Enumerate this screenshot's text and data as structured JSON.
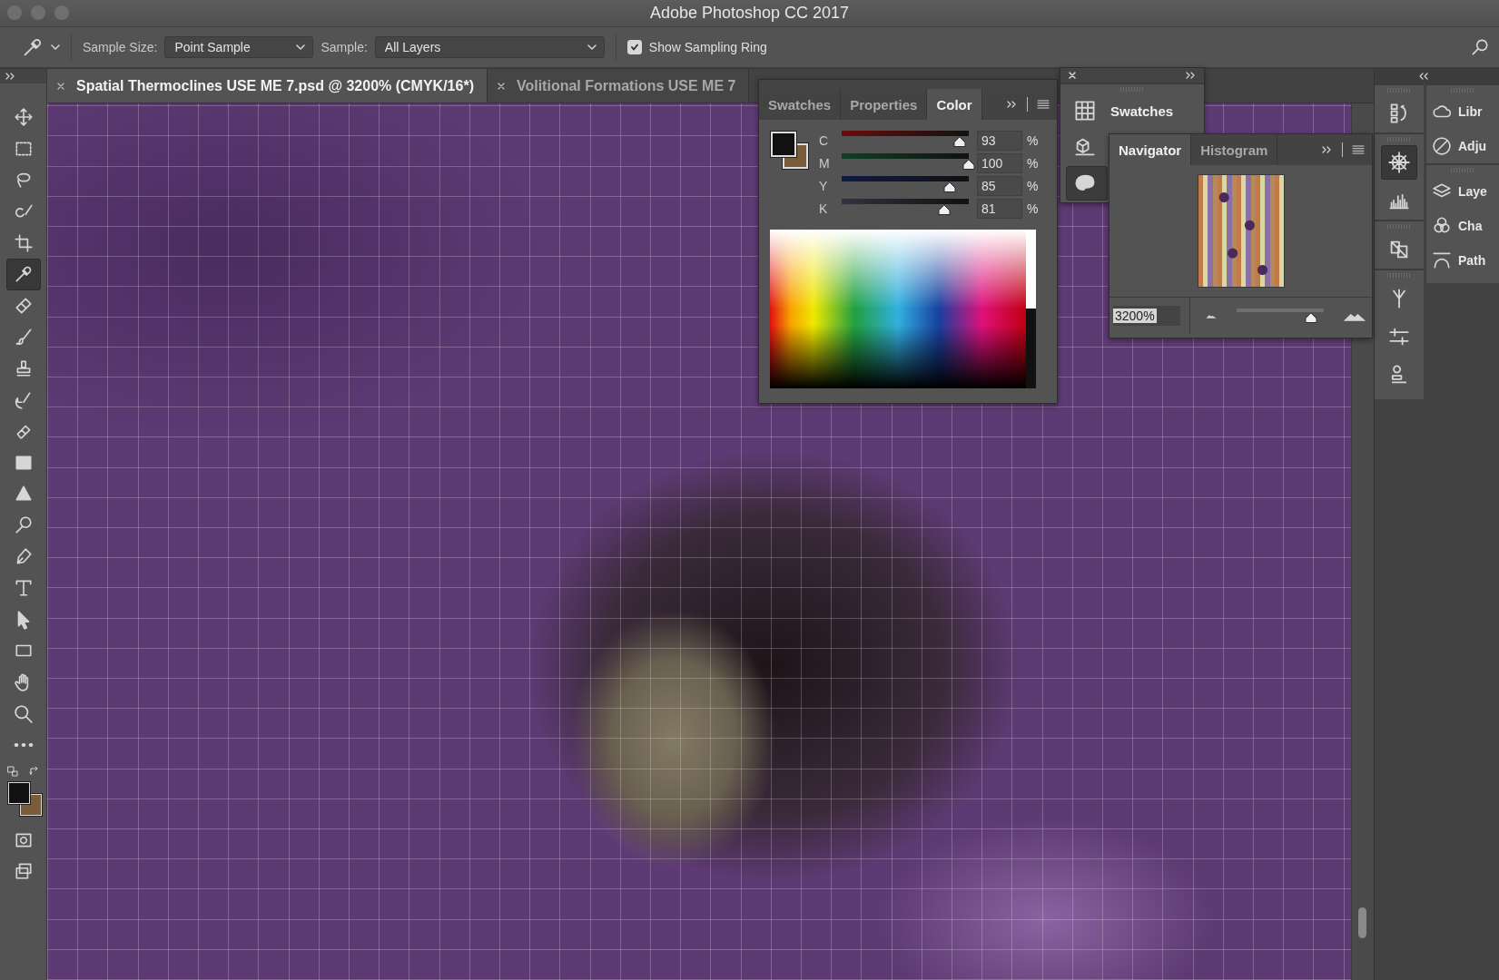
{
  "window": {
    "title": "Adobe Photoshop CC 2017"
  },
  "options_bar": {
    "sample_size_label": "Sample Size:",
    "sample_size": "Point Sample",
    "sample_label": "Sample:",
    "sample": "All Layers",
    "sampling_ring": {
      "label": "Show Sampling Ring",
      "checked": true
    }
  },
  "document_tabs": [
    {
      "title": "Spatial Thermoclines USE ME 7.psd @ 3200% (CMYK/16*)",
      "selected": true
    },
    {
      "title": "Volitional Formations USE ME 7",
      "selected": false
    }
  ],
  "tools": [
    {
      "kind": "move",
      "selected": false
    },
    {
      "kind": "marquee",
      "selected": false
    },
    {
      "kind": "lasso",
      "selected": false
    },
    {
      "kind": "quick-select",
      "selected": false
    },
    {
      "kind": "crop",
      "selected": false
    },
    {
      "kind": "eyedropper",
      "selected": true
    },
    {
      "kind": "healing",
      "selected": false
    },
    {
      "kind": "brush",
      "selected": false
    },
    {
      "kind": "stamp",
      "selected": false
    },
    {
      "kind": "history-brush",
      "selected": false
    },
    {
      "kind": "eraser",
      "selected": false
    },
    {
      "kind": "gradient",
      "selected": false
    },
    {
      "kind": "blur",
      "selected": false
    },
    {
      "kind": "dodge",
      "selected": false
    },
    {
      "kind": "pen",
      "selected": false
    },
    {
      "kind": "type",
      "selected": false
    },
    {
      "kind": "path-select",
      "selected": false
    },
    {
      "kind": "rectangle",
      "selected": false
    },
    {
      "kind": "hand",
      "selected": false
    },
    {
      "kind": "zoom",
      "selected": false
    },
    {
      "kind": "more",
      "selected": false
    }
  ],
  "color_swatches": [
    {
      "kind": "foreground",
      "color": "#111111"
    },
    {
      "kind": "background",
      "color": "#7a5c3a"
    }
  ],
  "color_panel": {
    "tabs": [
      {
        "label": "Swatches",
        "selected": false
      },
      {
        "label": "Properties",
        "selected": false
      },
      {
        "label": "Color",
        "selected": true
      }
    ],
    "channels": [
      {
        "name": "C",
        "level": 0.93,
        "value": "93",
        "unit": "%"
      },
      {
        "name": "M",
        "level": 1.0,
        "value": "100",
        "unit": "%"
      },
      {
        "name": "Y",
        "level": 0.85,
        "value": "85",
        "unit": "%"
      },
      {
        "name": "K",
        "level": 0.81,
        "value": "81",
        "unit": "%"
      }
    ]
  },
  "swatches_panel": {
    "items": [
      {
        "kind": "swatches",
        "label": "Swatches",
        "selected": false
      },
      {
        "kind": "libraries",
        "selected": false
      },
      {
        "kind": "color",
        "selected": true
      }
    ]
  },
  "navigator_panel": {
    "tabs": [
      {
        "label": "Navigator",
        "selected": true
      },
      {
        "label": "Histogram",
        "selected": false
      }
    ],
    "zoom": "3200%",
    "level": 0.85
  },
  "dock_icons": [
    {
      "kind": "history",
      "selected": false
    },
    {
      "kind": "navigator",
      "selected": true
    },
    {
      "kind": "histogram",
      "selected": false
    },
    {
      "kind": "clone-source",
      "selected": false
    },
    {
      "kind": "brushes",
      "selected": false
    },
    {
      "kind": "brush-settings",
      "selected": false
    },
    {
      "kind": "tool-presets",
      "selected": false
    }
  ],
  "dock_panels": [
    {
      "kind": "libraries",
      "label": "Libr"
    },
    {
      "kind": "adjustments",
      "label": "Adju"
    },
    {
      "kind": "layers",
      "label": "Laye"
    },
    {
      "kind": "channels",
      "label": "Cha"
    },
    {
      "kind": "paths",
      "label": "Path"
    }
  ]
}
